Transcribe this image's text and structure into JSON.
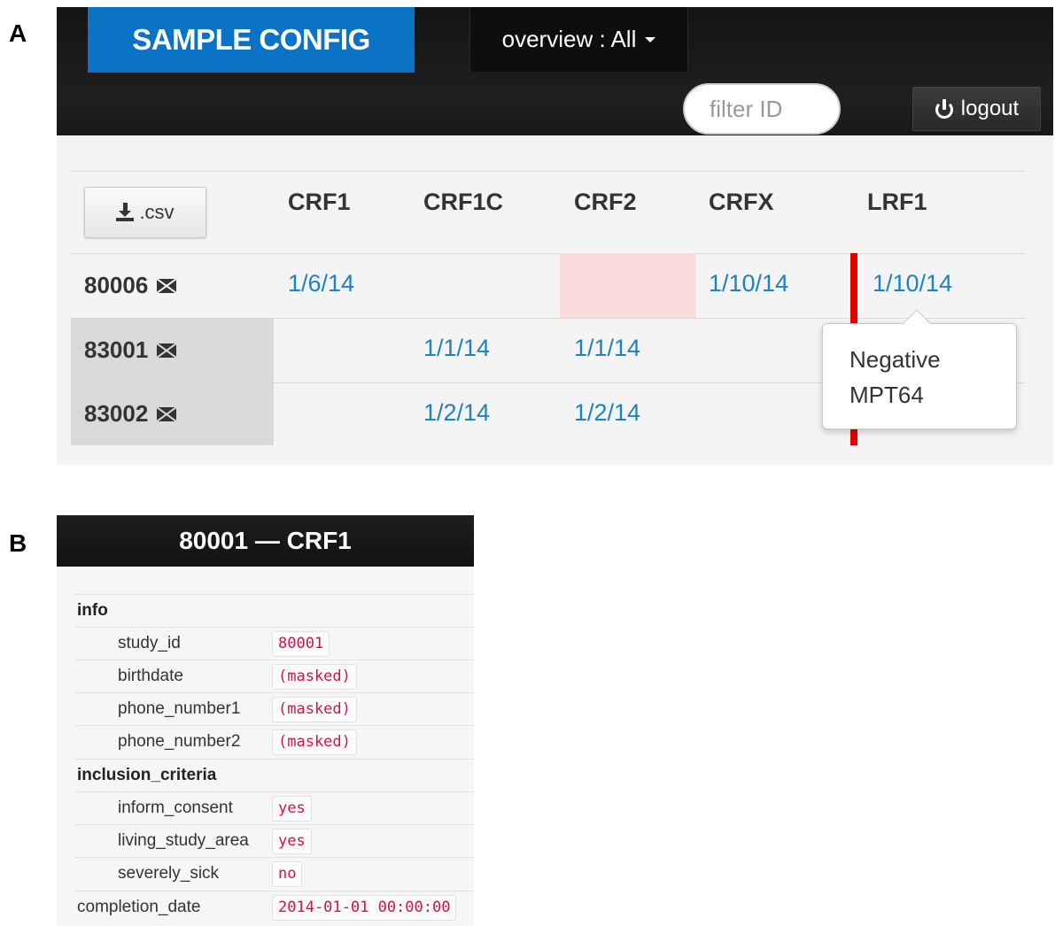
{
  "panel_labels": {
    "a": "A",
    "b": "B"
  },
  "navbar": {
    "brand": "SAMPLE CONFIG",
    "view_dropdown": "overview : All",
    "filter_placeholder": "filter ID",
    "logout_label": "logout"
  },
  "grid": {
    "csv_label": ".csv",
    "columns": [
      "CRF1",
      "CRF1C",
      "CRF2",
      "CRFX",
      "LRF1"
    ],
    "rows": [
      {
        "id": "80006",
        "CRF1": "1/6/14",
        "CRF1C": "",
        "CRF2": "",
        "CRFX": "1/10/14",
        "LRF1": "1/10/14"
      },
      {
        "id": "83001",
        "CRF1": "",
        "CRF1C": "1/1/14",
        "CRF2": "1/1/14",
        "CRFX": "",
        "LRF1": ""
      },
      {
        "id": "83002",
        "CRF1": "",
        "CRF1C": "1/2/14",
        "CRF2": "1/2/14",
        "CRFX": "",
        "LRF1": ""
      }
    ],
    "tooltip": {
      "line1": "Negative",
      "line2": "MPT64"
    }
  },
  "form": {
    "title": "80001 — CRF1",
    "sections": {
      "info": "info",
      "inclusion": "inclusion_criteria"
    },
    "fields": {
      "study_id": {
        "label": "study_id",
        "value": "80001"
      },
      "birthdate": {
        "label": "birthdate",
        "value": "(masked)"
      },
      "phone_number1": {
        "label": "phone_number1",
        "value": "(masked)"
      },
      "phone_number2": {
        "label": "phone_number2",
        "value": "(masked)"
      },
      "inform_consent": {
        "label": "inform_consent",
        "value": "yes"
      },
      "living_study_area": {
        "label": "living_study_area",
        "value": "yes"
      },
      "severely_sick": {
        "label": "severely_sick",
        "value": "no"
      },
      "completion_date": {
        "label": "completion_date",
        "value": "2014-01-01 00:00:00"
      }
    }
  },
  "colors": {
    "brand_blue": "#0b73c6",
    "link_blue": "#1b82c4",
    "highlight_pink": "#fbdada",
    "marker_red": "#e00000",
    "value_red": "#d1144b"
  }
}
